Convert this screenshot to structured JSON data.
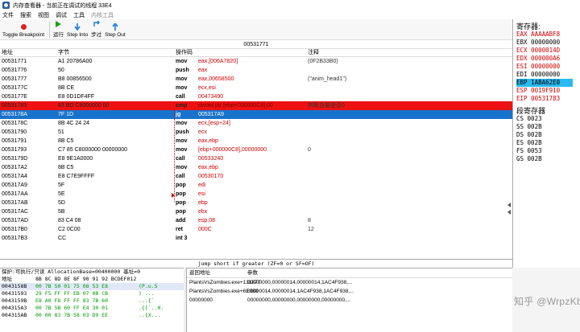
{
  "window": {
    "title": "内存查看器 - 当前正在调试的线程 33E4"
  },
  "menu": {
    "items": [
      "文件",
      "搜索",
      "视图",
      "调试",
      "工具"
    ],
    "disabled_item": "内核工具"
  },
  "toolbar": {
    "toggle_breakpoint": "Toggle Breakpoint",
    "run": "运行",
    "step_into": "Step Into",
    "step_over": "步过",
    "step_out": "Step Out"
  },
  "address_bar": {
    "value": "00531771"
  },
  "disasm": {
    "headers": {
      "address": "地址",
      "bytes": "字节",
      "opcode": "操作码",
      "comment": "注释"
    },
    "rows": [
      {
        "addr": "00531771",
        "bytes": "A1 20786A00",
        "mn": "mov",
        "arg": "eax,[006A7820]",
        "cmt": "(0F2B33B0)"
      },
      {
        "addr": "00531776",
        "bytes": "50",
        "mn": "push",
        "arg": "eax",
        "cmt": ""
      },
      {
        "addr": "00531777",
        "bytes": "B8 00856500",
        "mn": "mov",
        "arg": "eax,00658500",
        "cmt": "(\"anim_head1\")"
      },
      {
        "addr": "0053177C",
        "bytes": "8B CE",
        "mn": "mov",
        "arg": "ecx,esi",
        "cmt": ""
      },
      {
        "addr": "0053177E",
        "bytes": "E8 0D1DF4FF",
        "mn": "call",
        "arg": "00473490",
        "cmt": ""
      },
      {
        "addr": "00531783",
        "bytes": "83 BD C8000000 00",
        "mn": "cmp",
        "arg": "dword ptr [ebp+000000C8],00",
        "cmt": "判断血量是否0"
      },
      {
        "addr": "0053178A",
        "bytes": "7F 1D",
        "mn": "jg",
        "arg": "005317A9",
        "cmt": ""
      },
      {
        "addr": "0053178C",
        "bytes": "8B 4C 24 24",
        "mn": "mov",
        "arg": "ecx,[esp+24]",
        "cmt": ""
      },
      {
        "addr": "00531790",
        "bytes": "51",
        "mn": "push",
        "arg": "ecx",
        "cmt": ""
      },
      {
        "addr": "00531791",
        "bytes": "8B C5",
        "mn": "mov",
        "arg": "eax,ebp",
        "cmt": ""
      },
      {
        "addr": "00531793",
        "bytes": "C7 85 C8000000 00000000",
        "mn": "mov",
        "arg": "[ebp+000000C8],00000000",
        "cmt": "0"
      },
      {
        "addr": "0053179D",
        "bytes": "E8 9E1A0000",
        "mn": "call",
        "arg": "00533240",
        "cmt": ""
      },
      {
        "addr": "005317A2",
        "bytes": "8B C5",
        "mn": "mov",
        "arg": "eax,ebp",
        "cmt": ""
      },
      {
        "addr": "005317A4",
        "bytes": "E8 C7E9FFFF",
        "mn": "call",
        "arg": "00530170",
        "cmt": ""
      },
      {
        "addr": "005317A9",
        "bytes": "5F",
        "mn": "pop",
        "arg": "edi",
        "cmt": ""
      },
      {
        "addr": "005317AA",
        "bytes": "5E",
        "mn": "pop",
        "arg": "esi",
        "cmt": ""
      },
      {
        "addr": "005317AB",
        "bytes": "5D",
        "mn": "pop",
        "arg": "ebp",
        "cmt": ""
      },
      {
        "addr": "005317AC",
        "bytes": "5B",
        "mn": "pop",
        "arg": "ebx",
        "cmt": ""
      },
      {
        "addr": "005317AD",
        "bytes": "83 C4 08",
        "mn": "add",
        "arg": "esp,08",
        "cmt": "8"
      },
      {
        "addr": "005317B0",
        "bytes": "C2 0C00",
        "mn": "ret",
        "arg": "000C",
        "cmt": "12"
      },
      {
        "addr": "005317B3",
        "bytes": "CC",
        "mn": "int 3",
        "arg": "",
        "cmt": ""
      }
    ]
  },
  "status": {
    "text": "jump short if greater (ZF=0 or SF=OF)"
  },
  "registers": {
    "title": "寄存器:",
    "items": [
      {
        "text": "EAX AAAAABF8",
        "style": "red"
      },
      {
        "text": "EBX 00000000",
        "style": ""
      },
      {
        "text": "ECX 0000014D",
        "style": "red"
      },
      {
        "text": "EDX 000000A6",
        "style": "red"
      },
      {
        "text": "ESI 00000000",
        "style": "red"
      },
      {
        "text": "EDI 00000000",
        "style": ""
      },
      {
        "text": "EBP 1ABA62E0",
        "style": "hl"
      },
      {
        "text": "ESP 0019F910",
        "style": "red"
      },
      {
        "text": "EIP 00531783",
        "style": "red"
      }
    ],
    "seg_title": "段寄存器",
    "segs": [
      "CS 0023",
      "SS 002B",
      "DS 002B",
      "ES 002B",
      "FS 0053",
      "GS 002B"
    ]
  },
  "hex": {
    "info": "保护:可执行/只读  AllocationBase=00400000 基址=0",
    "header_addr": "地址",
    "header_bytes": "8B 8C 8D 8E 8F 90 91 92 BCDEF012",
    "rows": [
      {
        "a": "0043158B",
        "b": "00 7B 50 01 75 08 53 E8",
        "c": "(P.u.S"
      },
      {
        "a": "00431593",
        "b": "29 F5 FF FF EB 07 0B CB",
        ".c": "",
        "c": ") ..."
      },
      {
        "a": "0043159B",
        "b": "E8 A0 F8 FF FF 83 7B 60",
        "c": "...{`"
      },
      {
        "a": "004315A3",
        "b": "00 7B 5B 60 FF E4 30 01",
        "c": ".{[`..0."
      },
      {
        "a": "004315AB",
        "b": "00 00 83 7B 58 03 D9 EE",
        "c": "..{X..."
      }
    ]
  },
  "stack": {
    "headers": {
      "ret": "返回地址",
      "params": "参数"
    },
    "rows": [
      {
        "ret": "PlantsVsZombies.exe+131877",
        "params": "00000000,00000014,00000014,1AC4F938,..."
      },
      {
        "ret": "PlantsVsZombies.exe+6E080",
        "params": "00000014,00000014,1AC4F938,1AC4F938,..."
      },
      {
        "ret": "00000000",
        "params": "00000000,00000000,00000000,00000000,..."
      }
    ]
  },
  "watermark": {
    "text": "知乎 @WrpzKb"
  }
}
